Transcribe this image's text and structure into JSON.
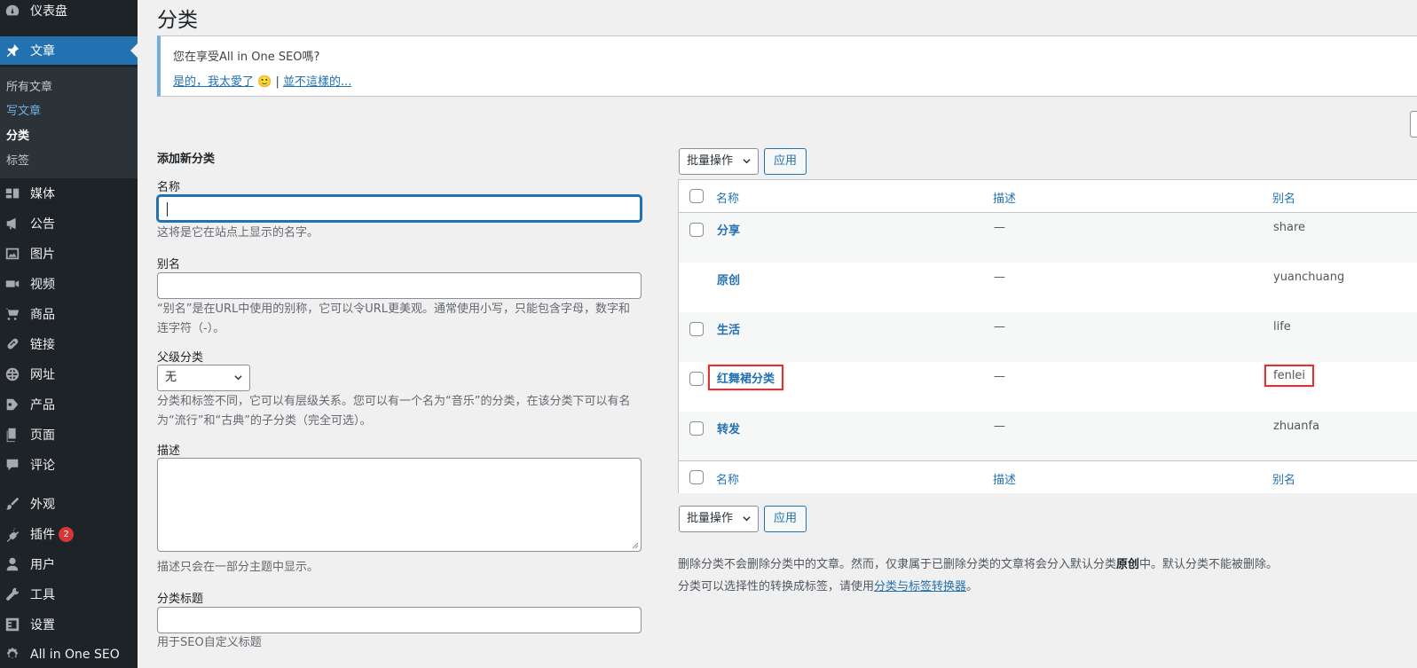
{
  "sidebar": {
    "items": [
      {
        "label": "仪表盘",
        "icon": "dashboard-icon"
      },
      {
        "label": "文章",
        "icon": "pin-icon",
        "current": true
      },
      {
        "label": "媒体",
        "icon": "media-icon"
      },
      {
        "label": "公告",
        "icon": "megaphone-icon"
      },
      {
        "label": "图片",
        "icon": "image-icon"
      },
      {
        "label": "视频",
        "icon": "video-icon"
      },
      {
        "label": "商品",
        "icon": "cart-icon"
      },
      {
        "label": "链接",
        "icon": "link-icon"
      },
      {
        "label": "网址",
        "icon": "globe-icon"
      },
      {
        "label": "产品",
        "icon": "product-icon"
      },
      {
        "label": "页面",
        "icon": "page-icon"
      },
      {
        "label": "评论",
        "icon": "comment-icon"
      },
      {
        "label": "外观",
        "icon": "brush-icon"
      },
      {
        "label": "插件",
        "icon": "plugin-icon",
        "badge": "2"
      },
      {
        "label": "用户",
        "icon": "user-icon"
      },
      {
        "label": "工具",
        "icon": "wrench-icon"
      },
      {
        "label": "设置",
        "icon": "settings-icon"
      },
      {
        "label": "All in One SEO",
        "icon": "aioseo-icon"
      }
    ],
    "submenu": [
      "所有文章",
      "写文章",
      "分类",
      "标签"
    ]
  },
  "page": {
    "title": "分类"
  },
  "notice": {
    "question": "您在享受All in One SEO嗎?",
    "yes_link": "是的，我太愛了",
    "separator": "|",
    "no_link": "並不這樣的..."
  },
  "form": {
    "heading": "添加新分类",
    "name_label": "名称",
    "name_help": "这将是它在站点上显示的名字。",
    "slug_label": "别名",
    "slug_help": "“别名”是在URL中使用的别称，它可以令URL更美观。通常使用小写，只能包含字母，数字和连字符（-）。",
    "parent_label": "父级分类",
    "parent_value": "无",
    "parent_help": "分类和标签不同，它可以有层级关系。您可以有一个名为“音乐”的分类，在该分类下可以有名为“流行”和“古典”的子分类（完全可选）。",
    "desc_label": "描述",
    "desc_help": "描述只会在一部分主题中显示。",
    "seo_title_label": "分类标题",
    "seo_title_help": "用于SEO自定义标题"
  },
  "table": {
    "bulk_label": "批量操作",
    "apply_label": "应用",
    "columns": [
      "名称",
      "描述",
      "别名"
    ],
    "rows": [
      {
        "name": "分享",
        "desc": "—",
        "slug": "share",
        "checkbox": true
      },
      {
        "name": "原创",
        "desc": "—",
        "slug": "yuanchuang",
        "checkbox": false
      },
      {
        "name": "生活",
        "desc": "—",
        "slug": "life",
        "checkbox": true
      },
      {
        "name": "红舞裙分类",
        "desc": "—",
        "slug": "fenlei",
        "checkbox": true,
        "highlight": true
      },
      {
        "name": "转发",
        "desc": "—",
        "slug": "zhuanfa",
        "checkbox": true
      }
    ]
  },
  "footer_notes": {
    "line1_a": "删除分类不会删除分类中的文章。然而，仅隶属于已删除分类的文章将会分入默认分类",
    "line1_b": "原创",
    "line1_c": "中。默认分类不能被删除。",
    "line2_a": "分类可以选择性的转换成标签，请使用",
    "line2_link": "分类与标签转换器",
    "line2_b": "。"
  },
  "colors": {
    "accent": "#2271b1",
    "sidebar": "#1d2327",
    "highlight": "#d63638"
  }
}
